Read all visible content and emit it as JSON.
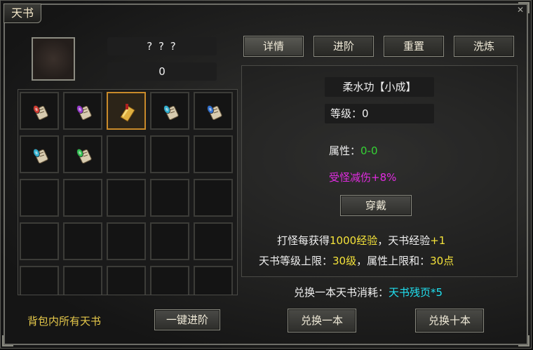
{
  "window": {
    "title": "天书",
    "close_icon": "close-icon"
  },
  "header": {
    "name": "? ? ?",
    "level": "0"
  },
  "tabs": [
    "详情",
    "进阶",
    "重置",
    "洗炼"
  ],
  "inventory": {
    "slots": [
      {
        "item": "red-scroll",
        "color": "#d03a30"
      },
      {
        "item": "purple-scroll",
        "color": "#9a3ad0"
      },
      {
        "item": "golden-book",
        "color": "#e0b040",
        "selected": true
      },
      {
        "item": "cyan-scroll",
        "color": "#30b0d0"
      },
      {
        "item": "blue-scroll",
        "color": "#3070d0"
      },
      {
        "item": "cyan-scroll",
        "color": "#30b0d0"
      },
      {
        "item": "green-scroll",
        "color": "#30c050"
      }
    ],
    "total_slots": 25,
    "footer_label": "背包内所有天书",
    "advance_all_button": "一键进阶"
  },
  "detail": {
    "book_name": "柔水功【小成】",
    "level_label": "等级：",
    "level_value": "0",
    "attr_label": "属性：",
    "attr_value": "0-0",
    "bonus": "受怪减伤+8%",
    "equip_button": "穿戴"
  },
  "info": {
    "line1_a": "打怪每获得",
    "line1_b": "1000经验",
    "line1_c": "，天书经验",
    "line1_d": "+1",
    "line2_a": "天书等级上限：",
    "line2_b": "30级",
    "line2_c": "，属性上限和：",
    "line2_d": "30点",
    "exchange_a": "兑换一本天书消耗：",
    "exchange_b": "天书残页*5"
  },
  "buttons": {
    "exchange_one": "兑换一本",
    "exchange_ten": "兑换十本"
  }
}
